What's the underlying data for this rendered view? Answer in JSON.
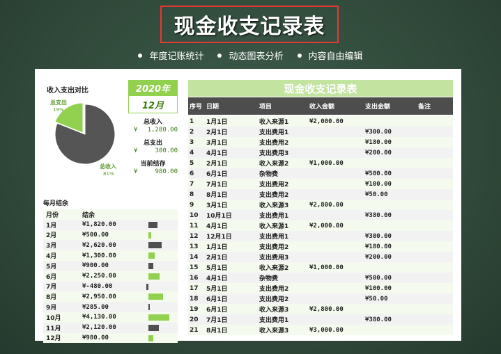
{
  "header": {
    "title": "现金收支记录表",
    "features": [
      "年度记账统计",
      "动态图表分析",
      "内容自由编辑"
    ]
  },
  "pie": {
    "title": "收入支出对比",
    "slices": [
      {
        "label": "总支出",
        "percent": 19,
        "pct_label": "19%",
        "color": "#92d050"
      },
      {
        "label": "总收入",
        "percent": 81,
        "pct_label": "81%",
        "color": "#555555"
      }
    ]
  },
  "summary": {
    "year": "2020年",
    "month": "12月",
    "income_label": "总收入",
    "income": "1,280.00",
    "expense_label": "总支出",
    "expense": "300.00",
    "balance_label": "当前结存",
    "balance": "980.00",
    "currency": "¥"
  },
  "monthly": {
    "title": "每月结余",
    "col_month": "月份",
    "col_balance": "结余",
    "rows": [
      {
        "m": "1月",
        "v": "¥1,820.00",
        "n": 1820
      },
      {
        "m": "2月",
        "v": "¥500.00",
        "n": 500
      },
      {
        "m": "3月",
        "v": "¥2,620.00",
        "n": 2620
      },
      {
        "m": "4月",
        "v": "¥1,300.00",
        "n": 1300
      },
      {
        "m": "5月",
        "v": "¥900.00",
        "n": 900
      },
      {
        "m": "6月",
        "v": "¥2,250.00",
        "n": 2250
      },
      {
        "m": "7月",
        "v": "¥-480.00",
        "n": -480
      },
      {
        "m": "8月",
        "v": "¥2,950.00",
        "n": 2950
      },
      {
        "m": "9月",
        "v": "¥285.00",
        "n": 285
      },
      {
        "m": "10月",
        "v": "¥4,130.00",
        "n": 4130
      },
      {
        "m": "11月",
        "v": "¥2,120.00",
        "n": 2120
      },
      {
        "m": "12月",
        "v": "¥980.00",
        "n": 980
      }
    ]
  },
  "records": {
    "title": "现金收支记录表",
    "columns": [
      "序号",
      "日期",
      "项目",
      "收入金额",
      "支出金额",
      "备注"
    ],
    "rows": [
      [
        "1",
        "1月1日",
        "收入来源1",
        "¥2,000.00",
        ""
      ],
      [
        "2",
        "2月1日",
        "支出费用1",
        "",
        "¥300.00"
      ],
      [
        "3",
        "3月1日",
        "支出费用2",
        "",
        "¥180.00"
      ],
      [
        "4",
        "4月1日",
        "支出费用3",
        "",
        "¥200.00"
      ],
      [
        "5",
        "2月1日",
        "收入来源2",
        "¥1,000.00",
        ""
      ],
      [
        "6",
        "6月1日",
        "杂物费",
        "",
        "¥500.00"
      ],
      [
        "7",
        "7月1日",
        "支出费用2",
        "",
        "¥100.00"
      ],
      [
        "8",
        "8月1日",
        "支出费用2",
        "",
        "¥50.00"
      ],
      [
        "9",
        "3月1日",
        "收入来源3",
        "¥2,800.00",
        ""
      ],
      [
        "10",
        "10月1日",
        "支出费用1",
        "",
        "¥380.00"
      ],
      [
        "11",
        "4月1日",
        "收入来源1",
        "¥2,000.00",
        ""
      ],
      [
        "12",
        "12月1日",
        "支出费用1",
        "",
        "¥300.00"
      ],
      [
        "13",
        "1月1日",
        "支出费用2",
        "",
        "¥180.00"
      ],
      [
        "14",
        "2月1日",
        "支出费用3",
        "",
        "¥200.00"
      ],
      [
        "15",
        "5月1日",
        "收入来源2",
        "¥1,000.00",
        ""
      ],
      [
        "16",
        "4月1日",
        "杂物费",
        "",
        "¥500.00"
      ],
      [
        "17",
        "5月1日",
        "支出费用2",
        "",
        "¥100.00"
      ],
      [
        "18",
        "6月1日",
        "支出费用2",
        "",
        "¥50.00"
      ],
      [
        "19",
        "6月1日",
        "收入来源3",
        "¥2,800.00",
        ""
      ],
      [
        "20",
        "7月1日",
        "支出费用1",
        "",
        "¥380.00"
      ],
      [
        "21",
        "8月1日",
        "收入来源3",
        "¥3,000.00",
        ""
      ]
    ]
  }
}
